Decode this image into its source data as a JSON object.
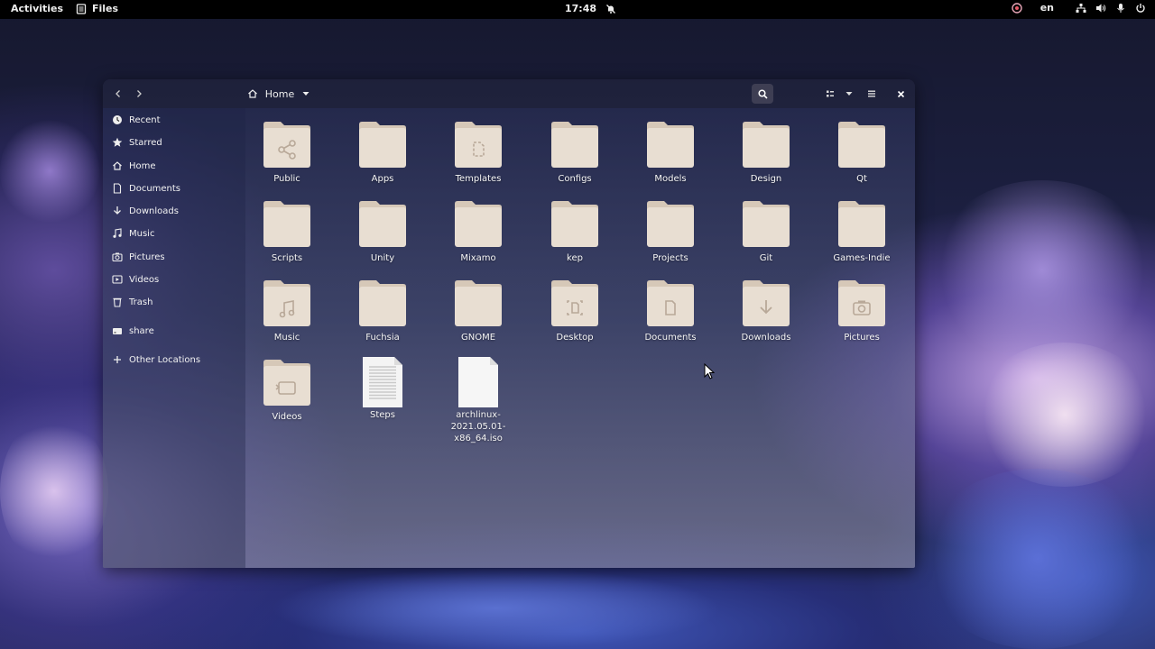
{
  "topbar": {
    "activities": "Activities",
    "app_name": "Files",
    "clock": "17:48",
    "language": "en"
  },
  "headerbar": {
    "location": "Home"
  },
  "sidebar": {
    "items": [
      {
        "label": "Recent",
        "icon": "clock-icon"
      },
      {
        "label": "Starred",
        "icon": "star-icon"
      },
      {
        "label": "Home",
        "icon": "home-icon"
      },
      {
        "label": "Documents",
        "icon": "document-icon"
      },
      {
        "label": "Downloads",
        "icon": "download-icon"
      },
      {
        "label": "Music",
        "icon": "music-icon"
      },
      {
        "label": "Pictures",
        "icon": "camera-icon"
      },
      {
        "label": "Videos",
        "icon": "video-icon"
      },
      {
        "label": "Trash",
        "icon": "trash-icon"
      },
      {
        "label": "share",
        "icon": "drive-icon"
      },
      {
        "label": "Other Locations",
        "icon": "plus-icon"
      }
    ]
  },
  "files": [
    {
      "name": "Public",
      "type": "folder",
      "emblem": "share"
    },
    {
      "name": "Apps",
      "type": "folder",
      "emblem": ""
    },
    {
      "name": "Templates",
      "type": "folder",
      "emblem": "template"
    },
    {
      "name": "Configs",
      "type": "folder",
      "emblem": ""
    },
    {
      "name": "Models",
      "type": "folder",
      "emblem": ""
    },
    {
      "name": "Design",
      "type": "folder",
      "emblem": ""
    },
    {
      "name": "Qt",
      "type": "folder",
      "emblem": ""
    },
    {
      "name": "Scripts",
      "type": "folder",
      "emblem": ""
    },
    {
      "name": "Unity",
      "type": "folder",
      "emblem": ""
    },
    {
      "name": "Mixamo",
      "type": "folder",
      "emblem": ""
    },
    {
      "name": "kep",
      "type": "folder",
      "emblem": ""
    },
    {
      "name": "Projects",
      "type": "folder",
      "emblem": ""
    },
    {
      "name": "Git",
      "type": "folder",
      "emblem": ""
    },
    {
      "name": "Games-Indie",
      "type": "folder",
      "emblem": ""
    },
    {
      "name": "Music",
      "type": "folder",
      "emblem": "music"
    },
    {
      "name": "Fuchsia",
      "type": "folder",
      "emblem": ""
    },
    {
      "name": "GNOME",
      "type": "folder",
      "emblem": ""
    },
    {
      "name": "Desktop",
      "type": "folder",
      "emblem": "desktop"
    },
    {
      "name": "Documents",
      "type": "folder",
      "emblem": "document"
    },
    {
      "name": "Downloads",
      "type": "folder",
      "emblem": "download"
    },
    {
      "name": "Pictures",
      "type": "folder",
      "emblem": "camera"
    },
    {
      "name": "Videos",
      "type": "folder",
      "emblem": "video"
    },
    {
      "name": "Steps",
      "type": "text-file",
      "emblem": ""
    },
    {
      "name": "archlinux-2021.05.01-x86_64.iso",
      "type": "iso-file",
      "emblem": ""
    }
  ],
  "colors": {
    "folder_body": "#e8ded2",
    "folder_tab": "#d6c8b8",
    "emblem": "#b8a898",
    "topbar": "#000000"
  }
}
